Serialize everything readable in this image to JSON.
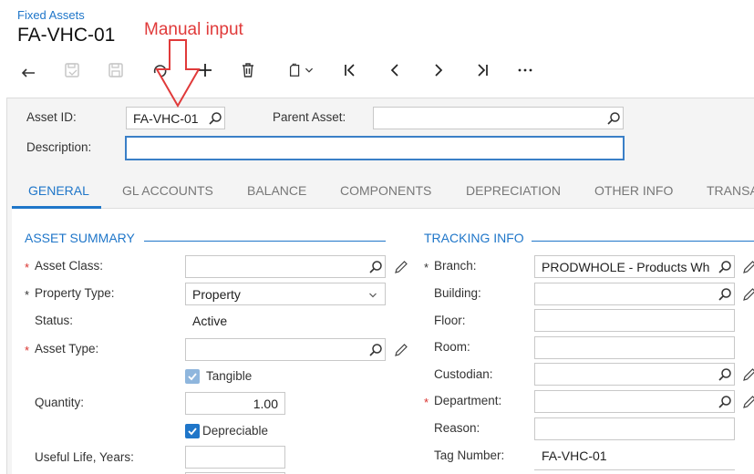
{
  "breadcrumb": "Fixed Assets",
  "title": "FA-VHC-01",
  "annotation": "Manual input",
  "toolbar": {
    "icons": [
      "back-arrow-icon",
      "save-close-icon",
      "save-icon",
      "undo-icon",
      "add-icon",
      "delete-icon",
      "clipboard-icon",
      "first-record-icon",
      "previous-record-icon",
      "next-record-icon",
      "last-record-icon",
      "more-icon"
    ]
  },
  "header": {
    "asset_id_label": "Asset ID:",
    "asset_id_value": "FA-VHC-01",
    "parent_asset_label": "Parent Asset:",
    "parent_asset_value": "",
    "description_label": "Description:",
    "description_value": ""
  },
  "tabs": [
    {
      "label": "GENERAL"
    },
    {
      "label": "GL ACCOUNTS"
    },
    {
      "label": "BALANCE"
    },
    {
      "label": "COMPONENTS"
    },
    {
      "label": "DEPRECIATION"
    },
    {
      "label": "OTHER INFO"
    },
    {
      "label": "TRANSA"
    }
  ],
  "asset_summary": {
    "title": "ASSET SUMMARY",
    "asset_class_label": "Asset Class:",
    "asset_class_value": "",
    "property_type_label": "Property Type:",
    "property_type_value": "Property",
    "status_label": "Status:",
    "status_value": "Active",
    "asset_type_label": "Asset Type:",
    "asset_type_value": "",
    "tangible_label": "Tangible",
    "tangible_checked": true,
    "quantity_label": "Quantity:",
    "quantity_value": "1.00",
    "depreciable_label": "Depreciable",
    "depreciable_checked": true,
    "useful_life_label": "Useful Life, Years:",
    "useful_life_value": ""
  },
  "tracking_info": {
    "title": "TRACKING INFO",
    "branch_label": "Branch:",
    "branch_value": "PRODWHOLE - Products Wh",
    "building_label": "Building:",
    "building_value": "",
    "floor_label": "Floor:",
    "floor_value": "",
    "room_label": "Room:",
    "room_value": "",
    "custodian_label": "Custodian:",
    "custodian_value": "",
    "department_label": "Department:",
    "department_value": "",
    "reason_label": "Reason:",
    "reason_value": "",
    "tag_number_label": "Tag Number:",
    "tag_number_value": "FA-VHC-01"
  },
  "colors": {
    "accent": "#1f76c9",
    "required": "#d9302c",
    "annotation": "#e03a3a"
  }
}
